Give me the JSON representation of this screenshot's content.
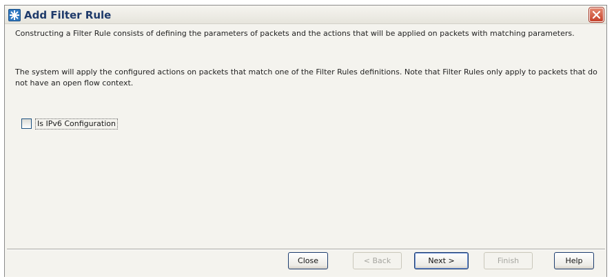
{
  "window": {
    "title": "Add Filter Rule"
  },
  "description": {
    "paragraph1": "Constructing a Filter Rule consists of defining the parameters of packets and the actions that will be applied on packets with matching parameters.",
    "paragraph2": "The system will apply the configured actions on packets that match one of the Filter Rules definitions. Note that Filter Rules only apply to packets that do not have an open flow context."
  },
  "options": {
    "ipv6_label": "Is IPv6 Configuration",
    "ipv6_checked": false
  },
  "buttons": {
    "close": "Close",
    "back": "< Back",
    "next": "Next >",
    "finish": "Finish",
    "help": "Help"
  }
}
